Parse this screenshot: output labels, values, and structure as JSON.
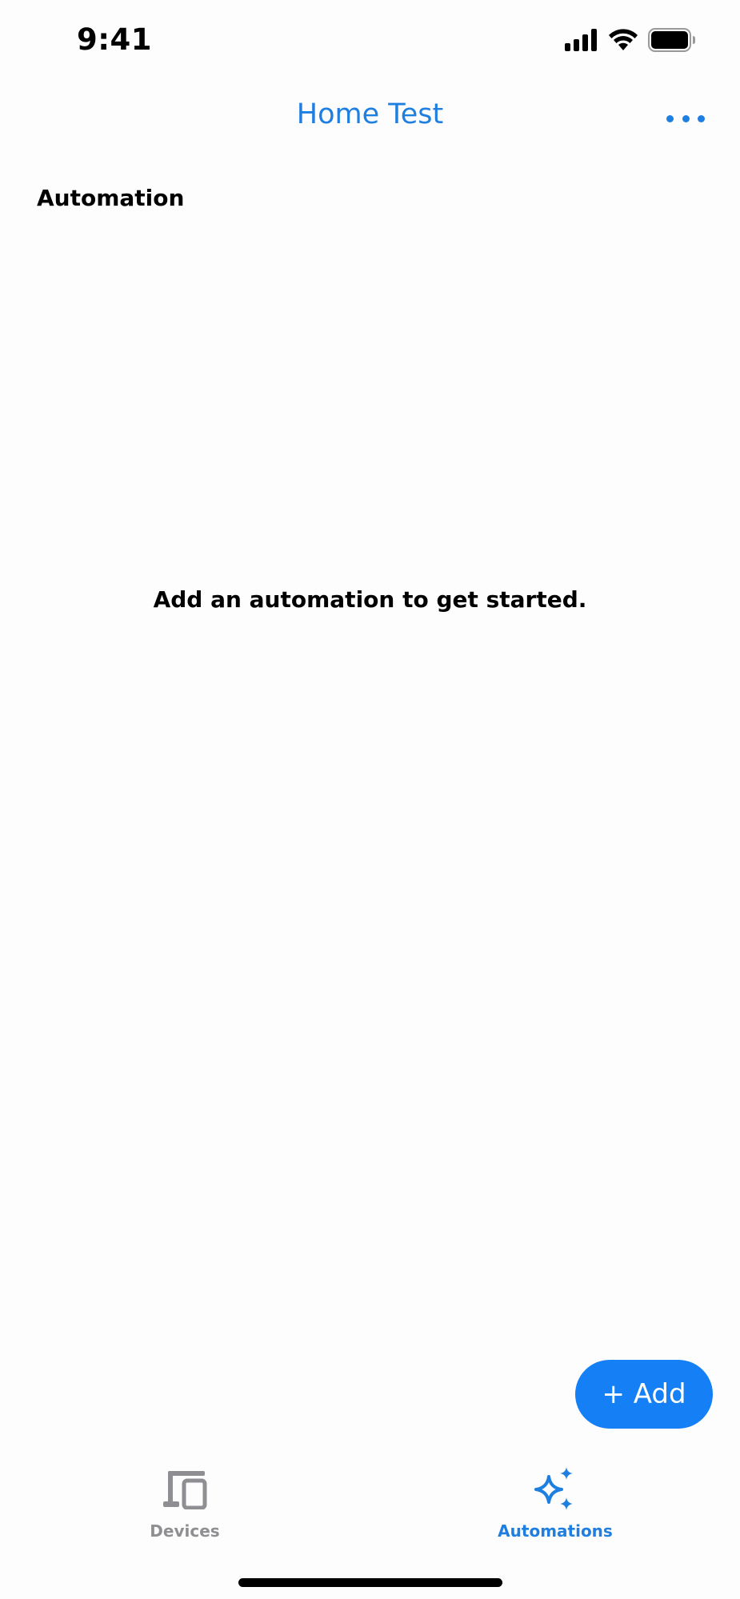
{
  "status_bar": {
    "time": "9:41",
    "icons": [
      "cellular-signal-icon",
      "wifi-icon",
      "battery-icon"
    ]
  },
  "nav": {
    "title": "Home Test",
    "more_icon": "ellipsis-icon"
  },
  "section": {
    "heading": "Automation"
  },
  "empty_state": {
    "message": "Add an automation to get started."
  },
  "add_button": {
    "label": "+ Add"
  },
  "tab_bar": {
    "tabs": [
      {
        "label": "Devices",
        "icon": "devices-icon",
        "selected": false
      },
      {
        "label": "Automations",
        "icon": "sparkles-icon",
        "selected": true
      }
    ]
  },
  "colors": {
    "accent": "#1f7fe0",
    "button": "#157ff5",
    "inactive_tab": "#8e8e93",
    "background": "#fdfdfd"
  }
}
